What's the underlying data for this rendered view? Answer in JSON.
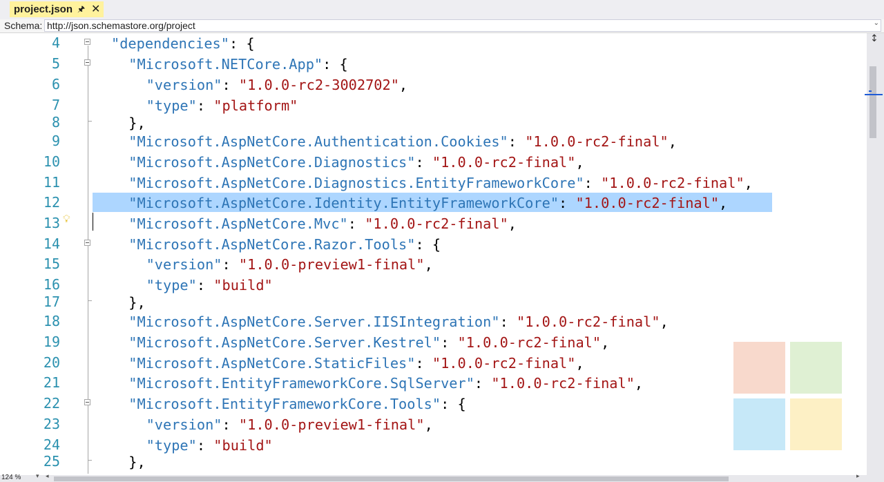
{
  "tab": {
    "title": "project.json",
    "pin_icon": "pin-icon",
    "close_icon": "close-icon"
  },
  "schema": {
    "label": "Schema:",
    "value": "http://json.schemastore.org/project"
  },
  "zoom": "124 %",
  "colors": {
    "key": "#2e75b6",
    "string": "#a31515",
    "line_number": "#2b91af",
    "selection": "#add6ff",
    "tab": "#fff29d"
  },
  "lines": [
    {
      "num": "4",
      "fold": true,
      "tokens": [
        [
          "k",
          "\"dependencies\""
        ],
        [
          "p",
          ": {"
        ]
      ],
      "indent": 0
    },
    {
      "num": "5",
      "fold": true,
      "tokens": [
        [
          "k",
          "\"Microsoft.NETCore.App\""
        ],
        [
          "p",
          ": {"
        ]
      ],
      "indent": 1
    },
    {
      "num": "6",
      "fold": false,
      "tokens": [
        [
          "k",
          "\"version\""
        ],
        [
          "p",
          ": "
        ],
        [
          "s",
          "\"1.0.0-rc2-3002702\""
        ],
        [
          "p",
          ","
        ]
      ],
      "indent": 2
    },
    {
      "num": "7",
      "fold": false,
      "tokens": [
        [
          "k",
          "\"type\""
        ],
        [
          "p",
          ": "
        ],
        [
          "s",
          "\"platform\""
        ]
      ],
      "indent": 2
    },
    {
      "num": "8",
      "fold": false,
      "tokens": [
        [
          "p",
          "},"
        ]
      ],
      "indent": 1
    },
    {
      "num": "9",
      "fold": false,
      "tokens": [
        [
          "k",
          "\"Microsoft.AspNetCore.Authentication.Cookies\""
        ],
        [
          "p",
          ": "
        ],
        [
          "s",
          "\"1.0.0-rc2-final\""
        ],
        [
          "p",
          ","
        ]
      ],
      "indent": 1
    },
    {
      "num": "10",
      "fold": false,
      "tokens": [
        [
          "k",
          "\"Microsoft.AspNetCore.Diagnostics\""
        ],
        [
          "p",
          ": "
        ],
        [
          "s",
          "\"1.0.0-rc2-final\""
        ],
        [
          "p",
          ","
        ]
      ],
      "indent": 1
    },
    {
      "num": "11",
      "fold": false,
      "tokens": [
        [
          "k",
          "\"Microsoft.AspNetCore.Diagnostics.EntityFrameworkCore\""
        ],
        [
          "p",
          ": "
        ],
        [
          "s",
          "\"1.0.0-rc2-final\""
        ],
        [
          "p",
          ","
        ]
      ],
      "indent": 1
    },
    {
      "num": "12",
      "fold": false,
      "tokens": [
        [
          "k",
          "\"Microsoft.AspNetCore.Identity.EntityFrameworkCore\""
        ],
        [
          "p",
          ": "
        ],
        [
          "s",
          "\"1.0.0-rc2-final\""
        ],
        [
          "p",
          ","
        ]
      ],
      "indent": 1
    },
    {
      "num": "13",
      "fold": false,
      "tokens": [
        [
          "k",
          "\"Microsoft.AspNetCore.Mvc\""
        ],
        [
          "p",
          ": "
        ],
        [
          "s",
          "\"1.0.0-rc2-final\""
        ],
        [
          "p",
          ","
        ]
      ],
      "indent": 1
    },
    {
      "num": "14",
      "fold": true,
      "tokens": [
        [
          "k",
          "\"Microsoft.AspNetCore.Razor.Tools\""
        ],
        [
          "p",
          ": {"
        ]
      ],
      "indent": 1
    },
    {
      "num": "15",
      "fold": false,
      "tokens": [
        [
          "k",
          "\"version\""
        ],
        [
          "p",
          ": "
        ],
        [
          "s",
          "\"1.0.0-preview1-final\""
        ],
        [
          "p",
          ","
        ]
      ],
      "indent": 2
    },
    {
      "num": "16",
      "fold": false,
      "tokens": [
        [
          "k",
          "\"type\""
        ],
        [
          "p",
          ": "
        ],
        [
          "s",
          "\"build\""
        ]
      ],
      "indent": 2
    },
    {
      "num": "17",
      "fold": false,
      "tokens": [
        [
          "p",
          "},"
        ]
      ],
      "indent": 1
    },
    {
      "num": "18",
      "fold": false,
      "tokens": [
        [
          "k",
          "\"Microsoft.AspNetCore.Server.IISIntegration\""
        ],
        [
          "p",
          ": "
        ],
        [
          "s",
          "\"1.0.0-rc2-final\""
        ],
        [
          "p",
          ","
        ]
      ],
      "indent": 1
    },
    {
      "num": "19",
      "fold": false,
      "tokens": [
        [
          "k",
          "\"Microsoft.AspNetCore.Server.Kestrel\""
        ],
        [
          "p",
          ": "
        ],
        [
          "s",
          "\"1.0.0-rc2-final\""
        ],
        [
          "p",
          ","
        ]
      ],
      "indent": 1
    },
    {
      "num": "20",
      "fold": false,
      "tokens": [
        [
          "k",
          "\"Microsoft.AspNetCore.StaticFiles\""
        ],
        [
          "p",
          ": "
        ],
        [
          "s",
          "\"1.0.0-rc2-final\""
        ],
        [
          "p",
          ","
        ]
      ],
      "indent": 1
    },
    {
      "num": "21",
      "fold": false,
      "tokens": [
        [
          "k",
          "\"Microsoft.EntityFrameworkCore.SqlServer\""
        ],
        [
          "p",
          ": "
        ],
        [
          "s",
          "\"1.0.0-rc2-final\""
        ],
        [
          "p",
          ","
        ]
      ],
      "indent": 1
    },
    {
      "num": "22",
      "fold": true,
      "tokens": [
        [
          "k",
          "\"Microsoft.EntityFrameworkCore.Tools\""
        ],
        [
          "p",
          ": {"
        ]
      ],
      "indent": 1
    },
    {
      "num": "23",
      "fold": false,
      "tokens": [
        [
          "k",
          "\"version\""
        ],
        [
          "p",
          ": "
        ],
        [
          "s",
          "\"1.0.0-preview1-final\""
        ],
        [
          "p",
          ","
        ]
      ],
      "indent": 2
    },
    {
      "num": "24",
      "fold": false,
      "tokens": [
        [
          "k",
          "\"type\""
        ],
        [
          "p",
          ": "
        ],
        [
          "s",
          "\"build\""
        ]
      ],
      "indent": 2
    },
    {
      "num": "25",
      "fold": false,
      "tokens": [
        [
          "p",
          "},"
        ]
      ],
      "indent": 1
    }
  ],
  "selected_line": "12",
  "watermark_colors": [
    "#f8d9cc",
    "#dff0d3",
    "#c6e8f8",
    "#fdf0c5"
  ]
}
